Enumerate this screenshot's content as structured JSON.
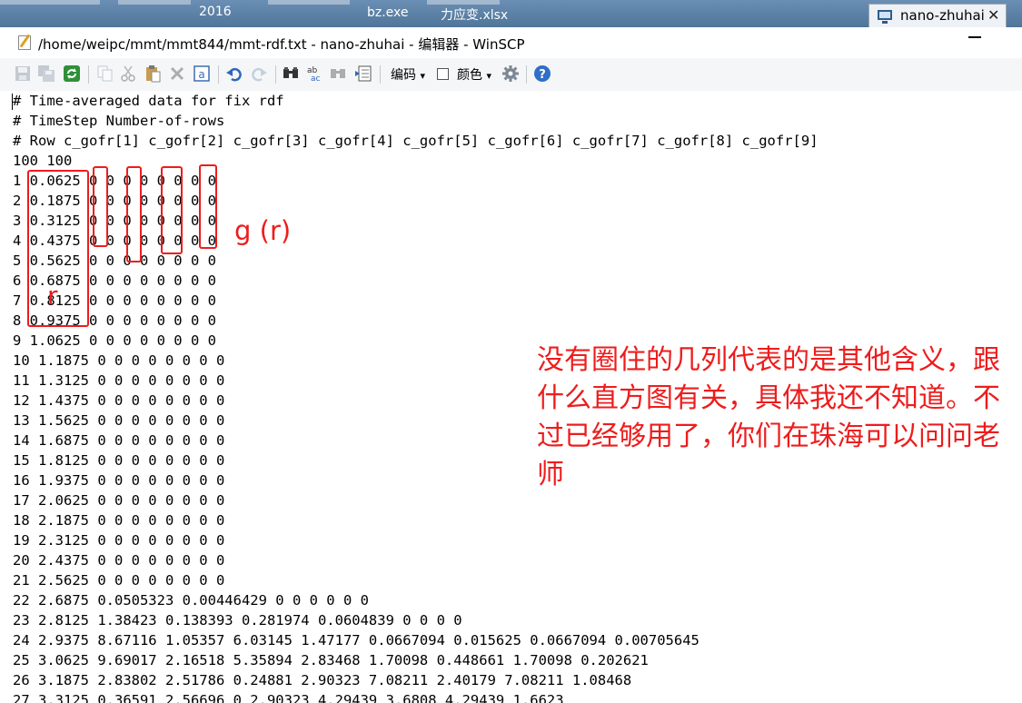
{
  "desktop": {
    "items": [
      "2016",
      "bz.exe",
      "力应变.xlsx"
    ]
  },
  "taskbar": {
    "tab_label": "nano-zhuhai",
    "close": "✕"
  },
  "window": {
    "title": "/home/weipc/mmt/mmt844/mmt-rdf.txt - nano-zhuhai - 编辑器 - WinSCP"
  },
  "toolbar": {
    "encoding_label": "编码",
    "color_label": "颜色",
    "dropdown_arrow": "▾"
  },
  "file_lines": [
    "# Time-averaged data for fix rdf",
    "# TimeStep Number-of-rows",
    "# Row c_gofr[1] c_gofr[2] c_gofr[3] c_gofr[4] c_gofr[5] c_gofr[6] c_gofr[7] c_gofr[8] c_gofr[9]",
    "100 100",
    "1 0.0625 0 0 0 0 0 0 0 0",
    "2 0.1875 0 0 0 0 0 0 0 0",
    "3 0.3125 0 0 0 0 0 0 0 0",
    "4 0.4375 0 0 0 0 0 0 0 0",
    "5 0.5625 0 0 0 0 0 0 0 0",
    "6 0.6875 0 0 0 0 0 0 0 0",
    "7 0.8125 0 0 0 0 0 0 0 0",
    "8 0.9375 0 0 0 0 0 0 0 0",
    "9 1.0625 0 0 0 0 0 0 0 0",
    "10 1.1875 0 0 0 0 0 0 0 0",
    "11 1.3125 0 0 0 0 0 0 0 0",
    "12 1.4375 0 0 0 0 0 0 0 0",
    "13 1.5625 0 0 0 0 0 0 0 0",
    "14 1.6875 0 0 0 0 0 0 0 0",
    "15 1.8125 0 0 0 0 0 0 0 0",
    "16 1.9375 0 0 0 0 0 0 0 0",
    "17 2.0625 0 0 0 0 0 0 0 0",
    "18 2.1875 0 0 0 0 0 0 0 0",
    "19 2.3125 0 0 0 0 0 0 0 0",
    "20 2.4375 0 0 0 0 0 0 0 0",
    "21 2.5625 0 0 0 0 0 0 0 0",
    "22 2.6875 0.0505323 0.00446429 0 0 0 0 0 0",
    "23 2.8125 1.38423 0.138393 0.281974 0.0604839 0 0 0 0",
    "24 2.9375 8.67116 1.05357 6.03145 1.47177 0.0667094 0.015625 0.0667094 0.00705645",
    "25 3.0625 9.69017 2.16518 5.35894 2.83468 1.70098 0.448661 1.70098 0.202621",
    "26 3.1875 2.83802 2.51786 0.24881 2.90323 7.08211 2.40179 7.08211 1.08468",
    "27 3.3125 0.36591 2.56696 0 2.90323 4.29439 3.6808 4.29439 1.6623"
  ],
  "annotations": {
    "g_label": "g (r)",
    "r_label": "r",
    "note": "没有圈住的几列代表的是其他含义，跟什么直方图有关，具体我还不知道。不过已经够用了，你们在珠海可以问问老师",
    "color": "#ee1c1c"
  },
  "icons": [
    "save-icon",
    "save-all-icon",
    "refresh-icon",
    "copy-icon",
    "cut-icon",
    "paste-icon",
    "delete-icon",
    "select-all-icon",
    "undo-icon",
    "redo-icon",
    "find-icon",
    "replace-icon",
    "find-next-icon",
    "goto-line-icon",
    "settings-gear-icon",
    "help-icon"
  ]
}
